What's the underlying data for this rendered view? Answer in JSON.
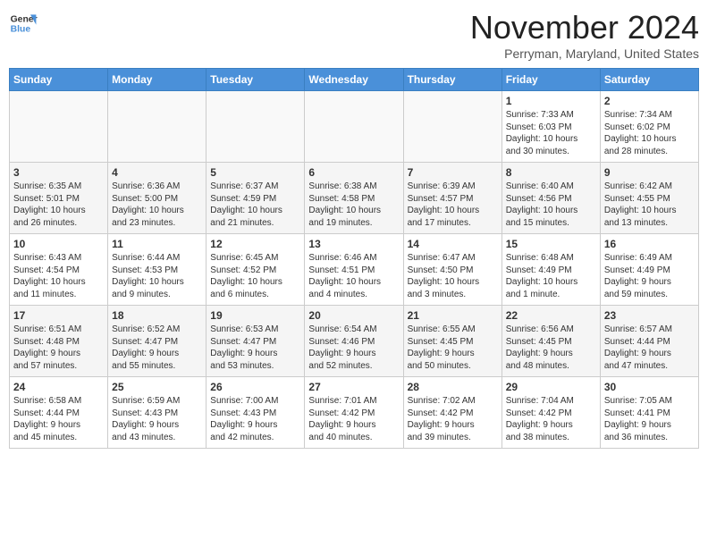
{
  "header": {
    "logo_general": "General",
    "logo_blue": "Blue",
    "month": "November 2024",
    "location": "Perryman, Maryland, United States"
  },
  "columns": [
    "Sunday",
    "Monday",
    "Tuesday",
    "Wednesday",
    "Thursday",
    "Friday",
    "Saturday"
  ],
  "weeks": [
    [
      {
        "day": "",
        "info": ""
      },
      {
        "day": "",
        "info": ""
      },
      {
        "day": "",
        "info": ""
      },
      {
        "day": "",
        "info": ""
      },
      {
        "day": "",
        "info": ""
      },
      {
        "day": "1",
        "info": "Sunrise: 7:33 AM\nSunset: 6:03 PM\nDaylight: 10 hours\nand 30 minutes."
      },
      {
        "day": "2",
        "info": "Sunrise: 7:34 AM\nSunset: 6:02 PM\nDaylight: 10 hours\nand 28 minutes."
      }
    ],
    [
      {
        "day": "3",
        "info": "Sunrise: 6:35 AM\nSunset: 5:01 PM\nDaylight: 10 hours\nand 26 minutes."
      },
      {
        "day": "4",
        "info": "Sunrise: 6:36 AM\nSunset: 5:00 PM\nDaylight: 10 hours\nand 23 minutes."
      },
      {
        "day": "5",
        "info": "Sunrise: 6:37 AM\nSunset: 4:59 PM\nDaylight: 10 hours\nand 21 minutes."
      },
      {
        "day": "6",
        "info": "Sunrise: 6:38 AM\nSunset: 4:58 PM\nDaylight: 10 hours\nand 19 minutes."
      },
      {
        "day": "7",
        "info": "Sunrise: 6:39 AM\nSunset: 4:57 PM\nDaylight: 10 hours\nand 17 minutes."
      },
      {
        "day": "8",
        "info": "Sunrise: 6:40 AM\nSunset: 4:56 PM\nDaylight: 10 hours\nand 15 minutes."
      },
      {
        "day": "9",
        "info": "Sunrise: 6:42 AM\nSunset: 4:55 PM\nDaylight: 10 hours\nand 13 minutes."
      }
    ],
    [
      {
        "day": "10",
        "info": "Sunrise: 6:43 AM\nSunset: 4:54 PM\nDaylight: 10 hours\nand 11 minutes."
      },
      {
        "day": "11",
        "info": "Sunrise: 6:44 AM\nSunset: 4:53 PM\nDaylight: 10 hours\nand 9 minutes."
      },
      {
        "day": "12",
        "info": "Sunrise: 6:45 AM\nSunset: 4:52 PM\nDaylight: 10 hours\nand 6 minutes."
      },
      {
        "day": "13",
        "info": "Sunrise: 6:46 AM\nSunset: 4:51 PM\nDaylight: 10 hours\nand 4 minutes."
      },
      {
        "day": "14",
        "info": "Sunrise: 6:47 AM\nSunset: 4:50 PM\nDaylight: 10 hours\nand 3 minutes."
      },
      {
        "day": "15",
        "info": "Sunrise: 6:48 AM\nSunset: 4:49 PM\nDaylight: 10 hours\nand 1 minute."
      },
      {
        "day": "16",
        "info": "Sunrise: 6:49 AM\nSunset: 4:49 PM\nDaylight: 9 hours\nand 59 minutes."
      }
    ],
    [
      {
        "day": "17",
        "info": "Sunrise: 6:51 AM\nSunset: 4:48 PM\nDaylight: 9 hours\nand 57 minutes."
      },
      {
        "day": "18",
        "info": "Sunrise: 6:52 AM\nSunset: 4:47 PM\nDaylight: 9 hours\nand 55 minutes."
      },
      {
        "day": "19",
        "info": "Sunrise: 6:53 AM\nSunset: 4:47 PM\nDaylight: 9 hours\nand 53 minutes."
      },
      {
        "day": "20",
        "info": "Sunrise: 6:54 AM\nSunset: 4:46 PM\nDaylight: 9 hours\nand 52 minutes."
      },
      {
        "day": "21",
        "info": "Sunrise: 6:55 AM\nSunset: 4:45 PM\nDaylight: 9 hours\nand 50 minutes."
      },
      {
        "day": "22",
        "info": "Sunrise: 6:56 AM\nSunset: 4:45 PM\nDaylight: 9 hours\nand 48 minutes."
      },
      {
        "day": "23",
        "info": "Sunrise: 6:57 AM\nSunset: 4:44 PM\nDaylight: 9 hours\nand 47 minutes."
      }
    ],
    [
      {
        "day": "24",
        "info": "Sunrise: 6:58 AM\nSunset: 4:44 PM\nDaylight: 9 hours\nand 45 minutes."
      },
      {
        "day": "25",
        "info": "Sunrise: 6:59 AM\nSunset: 4:43 PM\nDaylight: 9 hours\nand 43 minutes."
      },
      {
        "day": "26",
        "info": "Sunrise: 7:00 AM\nSunset: 4:43 PM\nDaylight: 9 hours\nand 42 minutes."
      },
      {
        "day": "27",
        "info": "Sunrise: 7:01 AM\nSunset: 4:42 PM\nDaylight: 9 hours\nand 40 minutes."
      },
      {
        "day": "28",
        "info": "Sunrise: 7:02 AM\nSunset: 4:42 PM\nDaylight: 9 hours\nand 39 minutes."
      },
      {
        "day": "29",
        "info": "Sunrise: 7:04 AM\nSunset: 4:42 PM\nDaylight: 9 hours\nand 38 minutes."
      },
      {
        "day": "30",
        "info": "Sunrise: 7:05 AM\nSunset: 4:41 PM\nDaylight: 9 hours\nand 36 minutes."
      }
    ]
  ]
}
